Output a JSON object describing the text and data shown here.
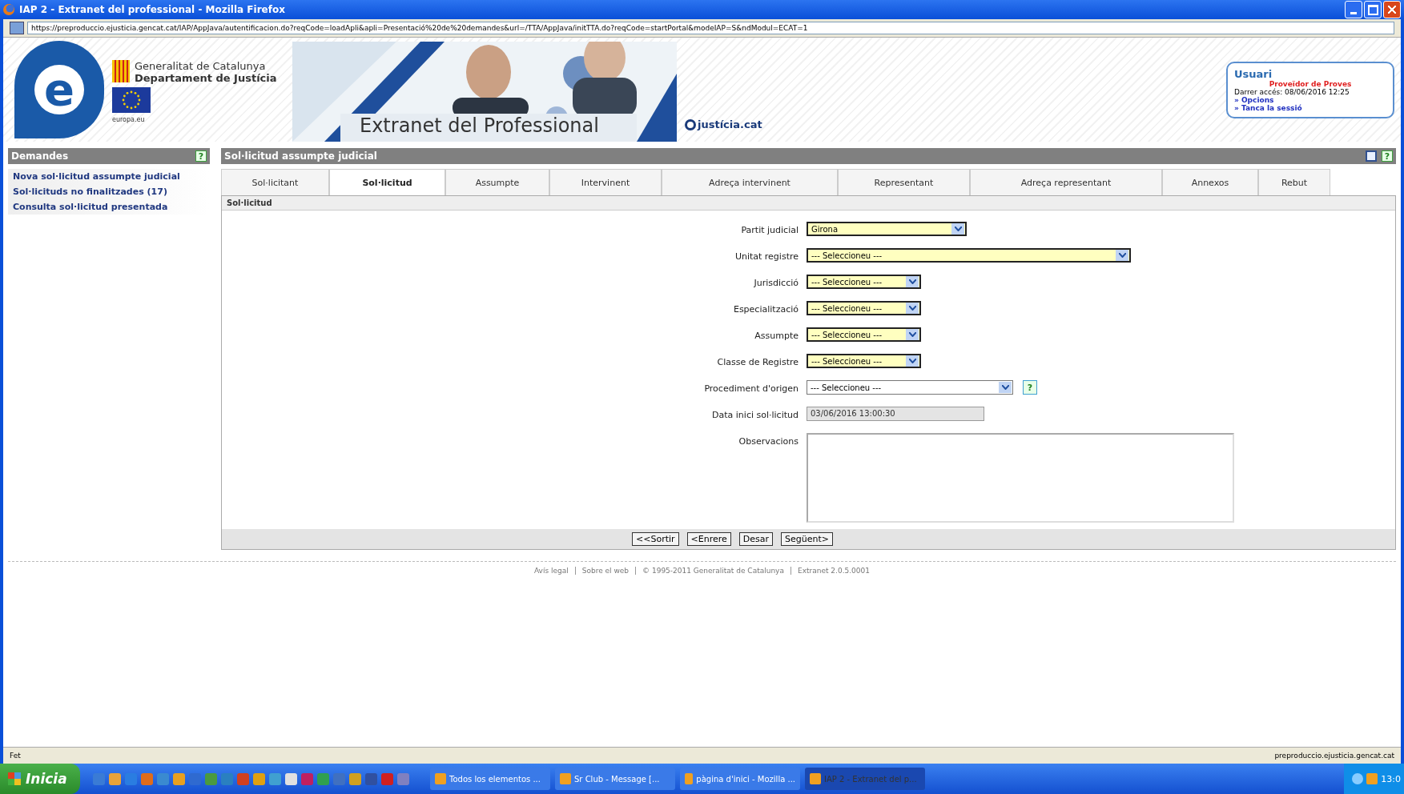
{
  "window": {
    "title": "IAP 2 - Extranet del professional - Mozilla Firefox"
  },
  "address_bar": {
    "url": "https://preproduccio.ejusticia.gencat.cat/IAP/AppJava/autentificacion.do?reqCode=loadApli&apli=Presentació%20de%20demandes&url=/TTA/AppJava/initTTA.do?reqCode=startPortal&modeIAP=S&ndModul=ECAT=1"
  },
  "header": {
    "logo_letter": "e",
    "org_name": "Generalitat de Catalunya",
    "department": "Departament de Justícia",
    "eu_label": "europa.eu",
    "site_title": "Extranet del Professional",
    "site_logo": "justícia.cat"
  },
  "user_box": {
    "title": "Usuari",
    "name": "Proveïdor de Proves",
    "last_access": "Darrer accés: 08/06/2016 12:25",
    "links": [
      "» Opcions",
      "» Tanca la sessió"
    ]
  },
  "sidebar": {
    "title": "Demandes",
    "help": "?",
    "items": [
      {
        "label": "Nova sol·licitud assumpte judicial"
      },
      {
        "label": "Sol·licituds no finalitzades (17)"
      },
      {
        "label": "Consulta sol·licitud presentada"
      }
    ]
  },
  "main": {
    "title": "Sol·licitud assumpte judicial",
    "help": "?",
    "tabs": [
      {
        "label": "Sol·licitant",
        "selected": false
      },
      {
        "label": "Sol·licitud",
        "selected": true
      },
      {
        "label": "Assumpte",
        "selected": false
      },
      {
        "label": "Intervinent",
        "selected": false
      },
      {
        "label": "Adreça intervinent",
        "selected": false
      },
      {
        "label": "Representant",
        "selected": false
      },
      {
        "label": "Adreça representant",
        "selected": false
      },
      {
        "label": "Annexos",
        "selected": false
      },
      {
        "label": "Rebut",
        "selected": false
      }
    ],
    "section": "Sol·licitud",
    "fields": [
      {
        "kind": "select",
        "label": "Partit judicial",
        "value": "Girona",
        "required": true
      },
      {
        "kind": "select",
        "label": "Unitat registre",
        "value": "--- Seleccioneu ---",
        "required": true
      },
      {
        "kind": "select",
        "label": "Jurisdicció",
        "value": "--- Seleccioneu ---",
        "required": true
      },
      {
        "kind": "select",
        "label": "Especialització",
        "value": "--- Seleccioneu ---",
        "required": true
      },
      {
        "kind": "select",
        "label": "Assumpte",
        "value": "--- Seleccioneu ---",
        "required": true
      },
      {
        "kind": "select",
        "label": "Classe de Registre",
        "value": "--- Seleccioneu ---",
        "required": true
      },
      {
        "kind": "select",
        "label": "Procediment d'origen",
        "value": "--- Seleccioneu ---",
        "required": false,
        "help": "?"
      },
      {
        "kind": "date",
        "label": "Data inici sol·licitud",
        "value": "03/06/2016 13:00:30",
        "disabled": true
      },
      {
        "kind": "textarea",
        "label": "Observacions"
      }
    ],
    "buttons": [
      "<<Sortir",
      "<Enrere",
      "Desar",
      "Següent>"
    ]
  },
  "footer": [
    "Avís legal",
    "Sobre el web",
    "© 1995-2011 Generalitat de Catalunya",
    "Extranet 2.0.5.0001"
  ],
  "status_bar": {
    "status": "Fet",
    "host": "preproduccio.ejusticia.gencat.cat"
  },
  "taskbar": {
    "start": "Inicia",
    "tasks": [
      {
        "label": "Todos los elementos ...",
        "selected": false
      },
      {
        "label": "Sr Club - Message [...",
        "selected": false
      },
      {
        "label": "pàgina d'inici - Mozilla ...",
        "selected": false
      },
      {
        "label": "IAP 2 - Extranet del p...",
        "selected": true
      }
    ],
    "clock": "13:0"
  }
}
